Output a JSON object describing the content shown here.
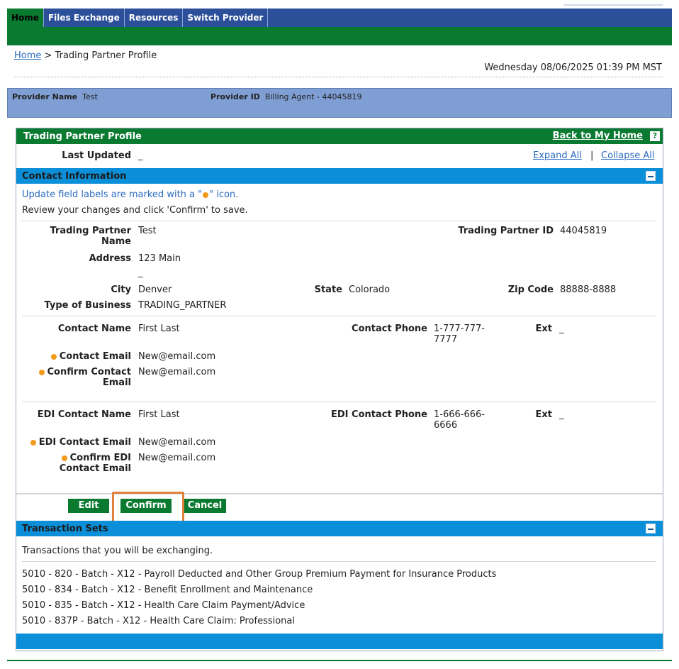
{
  "nav": {
    "tabs": [
      {
        "label": "Home",
        "active": true
      },
      {
        "label": "Files Exchange"
      },
      {
        "label": "Resources"
      },
      {
        "label": "Switch Provider"
      }
    ]
  },
  "breadcrumb": {
    "home": "Home",
    "separator": ">",
    "current": "Trading Partner Profile"
  },
  "datetime": "Wednesday 08/06/2025 01:39 PM MST",
  "provider": {
    "name_label": "Provider Name",
    "name_value": "Test",
    "id_label": "Provider ID",
    "id_value": "Billing Agent - 44045819"
  },
  "profile": {
    "title": "Trading Partner Profile",
    "back_link": "Back to My Home",
    "help_icon": "?",
    "last_updated_label": "Last Updated",
    "last_updated_value": "_",
    "expand_all": "Expand All",
    "divider": "|",
    "collapse_all": "Collapse All"
  },
  "contact": {
    "header": "Contact Information",
    "note_prefix": "Update field labels are marked with a \"",
    "note_suffix": "\" icon.",
    "review_note": "Review your changes and click 'Confirm' to save.",
    "tp_name_label_1": "Trading Partner",
    "tp_name_label_2": "Name",
    "tp_name_value": "Test",
    "tp_id_label": "Trading Partner ID",
    "tp_id_value": "44045819",
    "address_label": "Address",
    "address_line1": "123 Main",
    "address_line2": "_",
    "city_label": "City",
    "city_value": "Denver",
    "state_label": "State",
    "state_value": "Colorado",
    "zip_label": "Zip Code",
    "zip_value": "88888-8888",
    "tob_label": "Type of Business",
    "tob_value": "TRADING_PARTNER",
    "contact_name_label": "Contact Name",
    "contact_name_value": "First Last",
    "contact_phone_label": "Contact Phone",
    "contact_phone_line1": "1-777-777-",
    "contact_phone_line2": "7777",
    "ext_label": "Ext",
    "ext_value": "_",
    "contact_email_label": "Contact Email",
    "contact_email_value": "New@email.com",
    "confirm_email_label_1": "Confirm Contact",
    "confirm_email_label_2": "Email",
    "confirm_email_value": "New@email.com",
    "edi_name_label": "EDI Contact Name",
    "edi_name_value": "First Last",
    "edi_phone_label": "EDI Contact Phone",
    "edi_phone_line1": "1-666-666-",
    "edi_phone_line2": "6666",
    "edi_ext_label": "Ext",
    "edi_ext_value": "_",
    "edi_email_label": "EDI Contact Email",
    "edi_email_value": "New@email.com",
    "edi_confirm_label_1": "Confirm EDI",
    "edi_confirm_label_2": "Contact Email",
    "edi_confirm_value": "New@email.com"
  },
  "buttons": {
    "edit": "Edit",
    "confirm": "Confirm",
    "cancel": "Cancel"
  },
  "transactions": {
    "header": "Transaction Sets",
    "intro": "Transactions that you will be exchanging.",
    "items": [
      "5010 - 820 - Batch - X12 - Payroll Deducted and Other Group Premium Payment for Insurance Products",
      "5010 - 834 - Batch - X12 - Benefit Enrollment and Maintenance",
      "5010 - 835 - Batch - X12 - Health Care Claim Payment/Advice",
      "5010 - 837P - Batch - X12 - Health Care Claim: Professional"
    ]
  },
  "colors": {
    "nav_blue": "#2c4f9a",
    "green": "#0b7a31",
    "section_blue": "#0b8fd8",
    "required_dot": "#f29a1a",
    "highlight": "#e0803a"
  }
}
